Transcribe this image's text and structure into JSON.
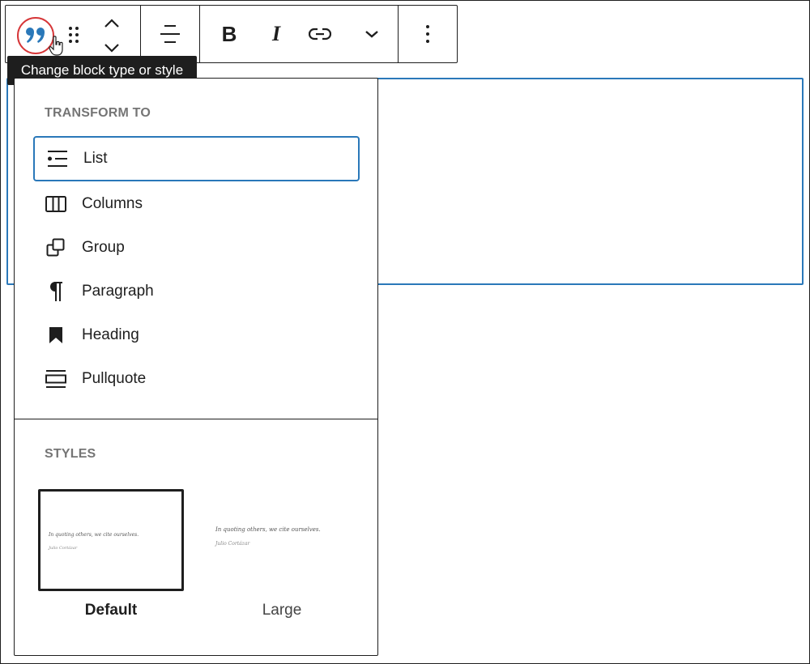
{
  "toolbar": {
    "block_type_icon": "quote-icon",
    "accent_color": "#2a78b9",
    "highlight_color": "#d63638",
    "tooltip": "Change block type or style",
    "bold_label": "B",
    "italic_label": "I"
  },
  "transform": {
    "heading": "TRANSFORM TO",
    "items": [
      {
        "label": "List",
        "icon": "list-icon"
      },
      {
        "label": "Columns",
        "icon": "columns-icon"
      },
      {
        "label": "Group",
        "icon": "group-icon"
      },
      {
        "label": "Paragraph",
        "icon": "paragraph-icon"
      },
      {
        "label": "Heading",
        "icon": "heading-icon"
      },
      {
        "label": "Pullquote",
        "icon": "pullquote-icon"
      }
    ]
  },
  "styles": {
    "heading": "STYLES",
    "preview_quote": "In quoting others, we cite ourselves.",
    "preview_cite": "Julio Cortázar",
    "options": [
      {
        "label": "Default",
        "selected": true
      },
      {
        "label": "Large",
        "selected": false
      }
    ]
  }
}
